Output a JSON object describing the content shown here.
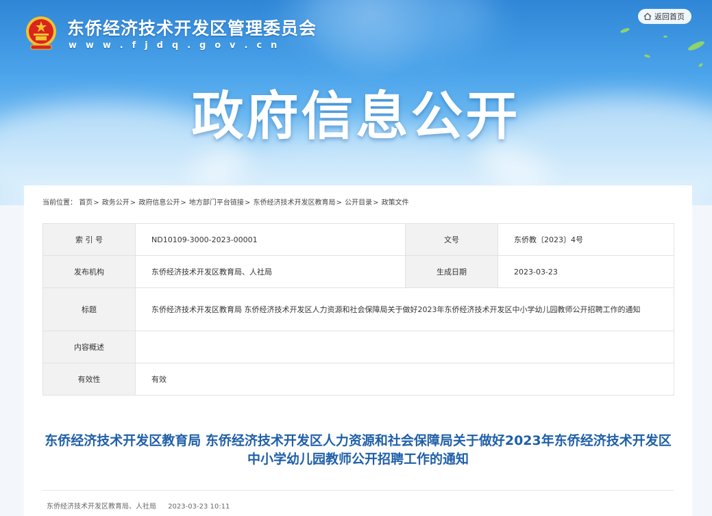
{
  "header": {
    "site_title": "东侨经济技术开发区管理委员会",
    "site_url": "w w w . f j d q . g o v . c n",
    "home_link": "返回首页",
    "banner_title": "政府信息公开"
  },
  "breadcrumb": {
    "prefix": "当前位置：",
    "items": [
      "首页",
      "政务公开",
      "政府信息公开",
      "地方部门平台链接",
      "东侨经济技术开发区教育局",
      "公开目录",
      "政策文件"
    ],
    "separator": ">"
  },
  "meta": {
    "index_label": "索 引 号",
    "index_value": "ND10109-3000-2023-00001",
    "docno_label": "文号",
    "docno_value": "东侨教〔2023〕4号",
    "publisher_label": "发布机构",
    "publisher_value": "东侨经济技术开发区教育局、人社局",
    "date_label": "生成日期",
    "date_value": "2023-03-23",
    "title_label": "标题",
    "title_value": "东侨经济技术开发区教育局 东侨经济技术开发区人力资源和社会保障局关于做好2023年东侨经济技术开发区中小学幼儿园教师公开招聘工作的通知",
    "summary_label": "内容概述",
    "summary_value": "",
    "validity_label": "有效性",
    "validity_value": "有效"
  },
  "article": {
    "title": "东侨经济技术开发区教育局 东侨经济技术开发区人力资源和社会保障局关于做好2023年东侨经济技术开发区中小学幼儿园教师公开招聘工作的通知",
    "source": "东侨经济技术开发区教育局、人社局",
    "datetime": "2023-03-23 10:11"
  },
  "colors": {
    "title_blue": "#1f5fa8",
    "emblem_red": "#d8261c",
    "emblem_gold": "#f2c230"
  }
}
